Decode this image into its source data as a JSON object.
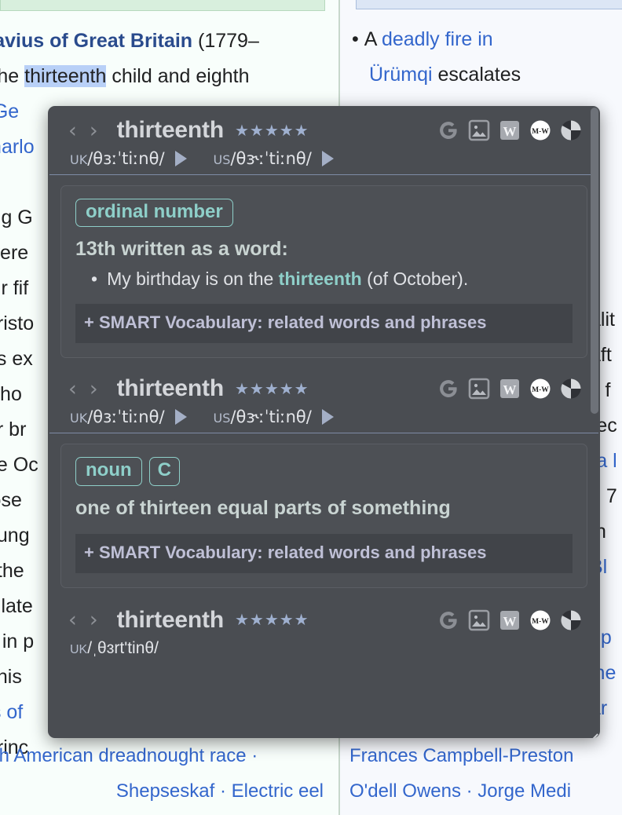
{
  "background": {
    "left_column": {
      "banner": "",
      "lead_paragraph_line1_bold": "ctavius of Great Britain",
      "lead_paragraph_line1_rest": " (1779–",
      "lead_paragraph_line2_a": "s the ",
      "lead_paragraph_line2_highlight": "thirteenth",
      "lead_paragraph_line2_b": " child and eighth",
      "lead_paragraph_line3": "g Ge",
      "lead_paragraph_line4": "Charlo",
      "clipped_lines": [
        "ing G",
        "were",
        "eir fif",
        "aristo",
        "as ex",
        "who",
        "er br",
        "pe Oc",
        "lose",
        "oung",
        "t the",
        "s late",
        "d in p",
        "f his",
        "ts of",
        "princ"
      ],
      "footer_line1": "th American dreadnought race ·",
      "footer_line2": "Shepseskaf · Electric eel"
    },
    "right_column": {
      "news_bullet_line1_a": "A ",
      "news_bullet_line1_link": "deadly fire in",
      "news_bullet_line2_link": "Ürümqi",
      "news_bullet_line2_rest": " escalates",
      "clipped_lines": [
        "alit",
        "aft",
        "s f",
        "rec",
        "ra l",
        "n 7",
        "th",
        "Bl",
        "up",
        "ine",
        "ar"
      ],
      "footer_line1": "Frances Campbell-Preston",
      "footer_line2": "O'dell Owens · Jorge Medi"
    }
  },
  "popup": {
    "colors": {
      "surface": "#4a4d52",
      "card": "#4d5055",
      "accent_teal": "#8ecfc9",
      "smart_text": "#bfc0d6",
      "star": "#9fb0cf",
      "word_text": "#d4d6da"
    },
    "source_icons": [
      {
        "name": "google-icon",
        "label": "G"
      },
      {
        "name": "images-icon",
        "label": "Ὓb"
      },
      {
        "name": "wikipedia-icon",
        "label": "W"
      },
      {
        "name": "merriam-webster-icon",
        "label": "M-W"
      },
      {
        "name": "wordreference-icon",
        "label": ""
      }
    ],
    "nav": {
      "prev": "‹",
      "next": "›"
    },
    "entries": [
      {
        "word": "thirteenth",
        "stars": "★★★★★",
        "uk_label": "UK",
        "uk_phonetic": "/θɜːˈtiːnθ/",
        "us_label": "US",
        "us_phonetic": "/θɝːˈtiːnθ/",
        "pos": [
          "ordinal number"
        ],
        "sense": "13th written as a word:",
        "example_pre": "My birthday is on the ",
        "example_keyword": "thirteenth",
        "example_post": " (of October).",
        "smart_vocab": "+ SMART Vocabulary: related words and phrases"
      },
      {
        "word": "thirteenth",
        "stars": "★★★★★",
        "uk_label": "UK",
        "uk_phonetic": "/θɜːˈtiːnθ/",
        "us_label": "US",
        "us_phonetic": "/θɝːˈtiːnθ/",
        "pos": [
          "noun",
          "C"
        ],
        "sense": "one of thirteen equal parts of something",
        "smart_vocab": "+ SMART Vocabulary: related words and phrases"
      },
      {
        "word": "thirteenth",
        "stars": "★★★★★",
        "uk_label": "UK",
        "uk_phonetic": "/ˌθɜrt'tinθ/"
      }
    ]
  }
}
